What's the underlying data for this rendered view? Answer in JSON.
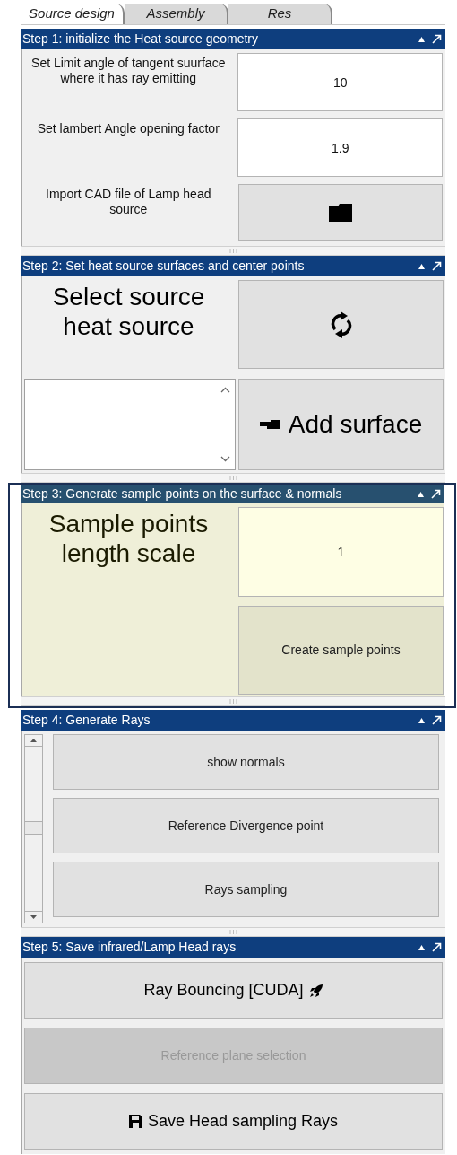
{
  "tabs": [
    {
      "label": "Source design",
      "selected": true
    },
    {
      "label": "Assembly",
      "selected": false
    },
    {
      "label": "Res",
      "selected": false
    }
  ],
  "panels": [
    {
      "kind": "form",
      "title": "Step 1: initialize the Heat source geometry",
      "highlighted": false,
      "rows": [
        {
          "kind": "field",
          "label": "Set Limit angle of tangent suurface where it has ray emitting",
          "value": "10"
        },
        {
          "kind": "field",
          "label": "Set lambert Angle opening factor",
          "value": "1.9"
        },
        {
          "kind": "folder",
          "label": "Import CAD file of Lamp head source"
        }
      ]
    },
    {
      "kind": "select",
      "title": "Step 2: Set heat source surfaces and center points",
      "highlighted": false,
      "label": "Select source heat source",
      "button": "Add surface"
    },
    {
      "kind": "sample",
      "title": "Step 3: Generate sample points on the surface & normals",
      "highlighted": true,
      "label": "Sample points length scale",
      "value": "1",
      "button": "Create sample points"
    },
    {
      "kind": "scroll_buttons",
      "title": "Step 4: Generate Rays",
      "highlighted": false,
      "buttons": [
        {
          "kind": "text",
          "label": "show normals",
          "disabled": false
        },
        {
          "kind": "text",
          "label": "Reference Divergence point",
          "disabled": false
        },
        {
          "kind": "text",
          "label": "Rays sampling",
          "disabled": false
        }
      ]
    },
    {
      "kind": "buttons",
      "title": "Step 5: Save infrared/Lamp Head rays",
      "highlighted": false,
      "buttons": [
        {
          "kind": "rocket",
          "label": "Ray Bouncing [CUDA]",
          "disabled": false
        },
        {
          "kind": "text",
          "label": "Reference plane selection",
          "disabled": true
        },
        {
          "kind": "save",
          "label": "Save Head sampling Rays",
          "disabled": false
        }
      ]
    }
  ]
}
